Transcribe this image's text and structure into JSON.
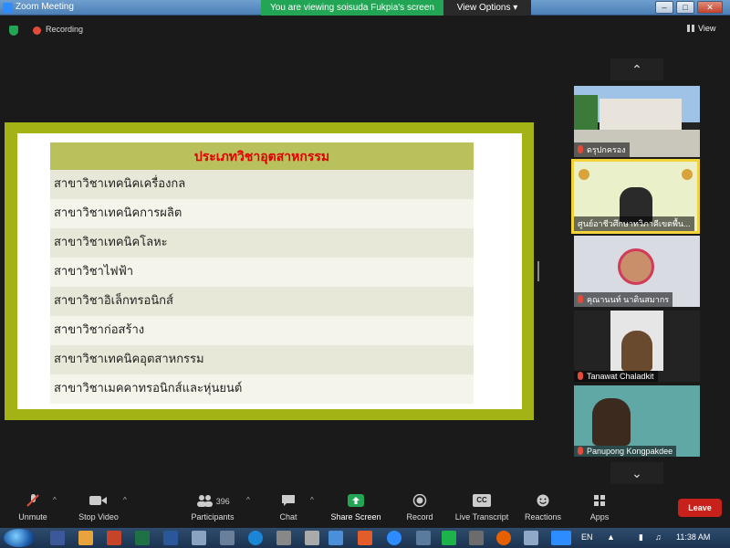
{
  "window": {
    "title": "Zoom Meeting",
    "share_banner": "You are viewing soisuda Fukpia's screen",
    "view_options": "View Options",
    "minimize": "–",
    "restore": "□",
    "close": "✕"
  },
  "status": {
    "recording": "Recording",
    "view": "View"
  },
  "slide": {
    "header": "ประเภทวิชาอุตสาหกรรม",
    "rows": [
      "สาขาวิชาเทคนิคเครื่องกล",
      "สาขาวิชาเทคนิคการผลิต",
      "สาขาวิชาเทคนิคโลหะ",
      "สาขาวิชาไฟฟ้า",
      "สาขาวิชาอิเล็กทรอนิกส์",
      "สาขาวิชาก่อสร้าง",
      "สาขาวิชาเทคนิคอุตสาหกรรม",
      "สาขาวิชาเมคคาทรอนิกส์และหุ่นยนต์"
    ]
  },
  "gallery": {
    "scroll_up": "⌃",
    "scroll_down": "⌄",
    "participants": [
      {
        "name": "ดรุปกครอง",
        "active": false,
        "muted": true
      },
      {
        "name": "ศูนย์อาชีวศึกษาทวิภาคีเขตพื้น...",
        "active": true,
        "muted": false
      },
      {
        "name": "คุณานนท์ นาดินสมากร",
        "active": false,
        "muted": true
      },
      {
        "name": "Tanawat Chaladkit",
        "active": false,
        "muted": true
      },
      {
        "name": "Panupong Kongpakdee",
        "active": false,
        "muted": true
      }
    ]
  },
  "toolbar": {
    "unmute": "Unmute",
    "stop_video": "Stop Video",
    "participants": "Participants",
    "participant_count": "396",
    "chat": "Chat",
    "share_screen": "Share Screen",
    "record": "Record",
    "live_transcript": "Live Transcript",
    "cc": "CC",
    "reactions": "Reactions",
    "apps": "Apps",
    "leave": "Leave",
    "caret": "^"
  },
  "taskbar": {
    "lang": "EN",
    "time": "11:38 AM"
  },
  "colors": {
    "accent_green": "#23a556",
    "leave_red": "#c8201a",
    "frame_olive": "#a3b316",
    "active_yellow": "#f3d23a"
  }
}
